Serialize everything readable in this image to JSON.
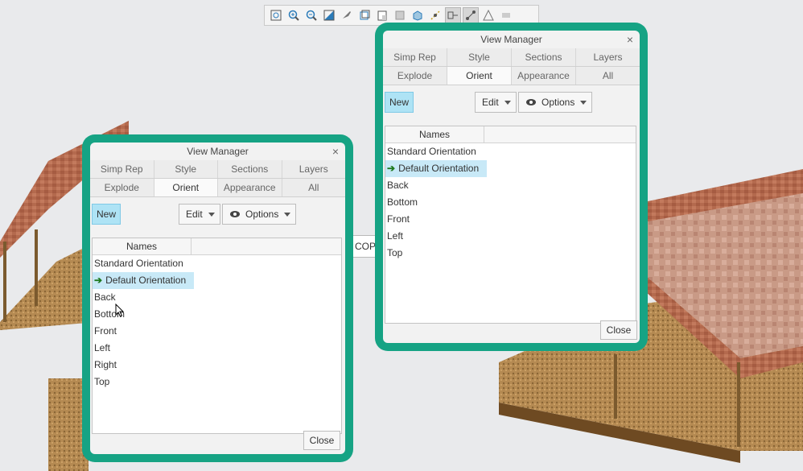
{
  "toolbar": {
    "icons": [
      "refit-icon",
      "zoom-in-icon",
      "zoom-out-icon",
      "repaint-icon",
      "spin-center-icon",
      "saved-orientations-icon",
      "named-views-icon",
      "layers-icon",
      "appearance-icon",
      "display-style-icon",
      "datum-display-icon",
      "plane-display-icon",
      "axis-display-icon",
      "shade-icon"
    ]
  },
  "model_label": "COPY_DACH",
  "dialog_left": {
    "title": "View Manager",
    "close_glyph": "×",
    "tabs_row1": [
      "Simp Rep",
      "Style",
      "Sections",
      "Layers"
    ],
    "tabs_row2": [
      "Explode",
      "Orient",
      "Appearance",
      "All"
    ],
    "active_tab": "Orient",
    "new_label": "New",
    "edit_label": "Edit",
    "options_label": "Options",
    "column_header": "Names",
    "items": [
      "Standard Orientation",
      "Default Orientation",
      "Back",
      "Bottom",
      "Front",
      "Left",
      "Right",
      "Top"
    ],
    "selected_item": "Default Orientation",
    "close_label": "Close"
  },
  "dialog_right": {
    "title": "View Manager",
    "close_glyph": "×",
    "tabs_row1": [
      "Simp Rep",
      "Style",
      "Sections",
      "Layers"
    ],
    "tabs_row2": [
      "Explode",
      "Orient",
      "Appearance",
      "All"
    ],
    "active_tab": "Orient",
    "new_label": "New",
    "edit_label": "Edit",
    "options_label": "Options",
    "column_header": "Names",
    "items": [
      "Standard Orientation",
      "Default Orientation",
      "Back",
      "Bottom",
      "Front",
      "Left",
      "Top"
    ],
    "selected_item": "Default Orientation",
    "close_label": "Close"
  },
  "colors": {
    "frame": "#16a384",
    "selection": "#c8e9f7",
    "new_button": "#aee3f5"
  }
}
